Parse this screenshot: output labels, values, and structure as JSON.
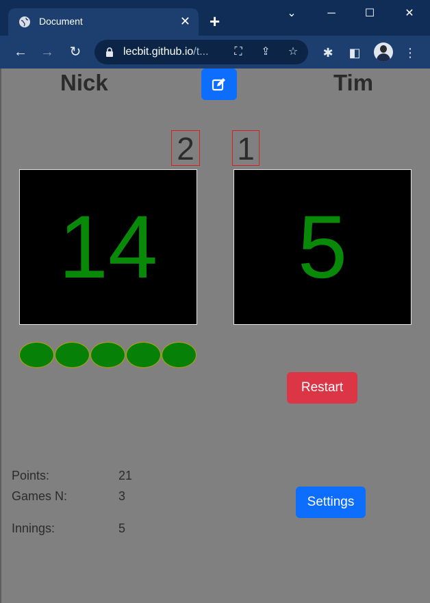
{
  "browser": {
    "tab_title": "Document",
    "url_host": "lecbit.github.io",
    "url_rest": "/t..."
  },
  "players": {
    "left_name": "Nick",
    "right_name": "Tim"
  },
  "games_won": {
    "left": "2",
    "right": "1"
  },
  "scores": {
    "left": "14",
    "right": "5"
  },
  "remaining_balls": 5,
  "buttons": {
    "restart": "Restart",
    "settings": "Settings"
  },
  "stats": {
    "points_label": "Points:",
    "points_value": "21",
    "games_label": "Games N:",
    "games_value": "3",
    "innings_label": "Innings:",
    "innings_value": "5"
  },
  "colors": {
    "score_green": "#088a08",
    "ball_green": "#068006",
    "restart_red": "#dc3545",
    "primary_blue": "#0d6efd"
  }
}
